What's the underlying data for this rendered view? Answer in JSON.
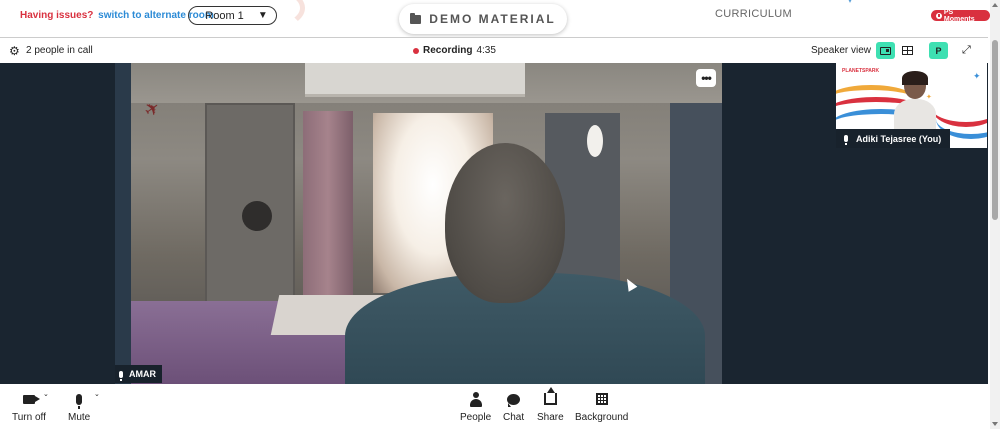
{
  "topbar": {
    "issue_text": "Having issues?",
    "alternate_link": "switch to alternate room",
    "room_select": "Room 1",
    "demo_button": "DEMO MATERIAL",
    "curriculum": "CURRICULUM",
    "moments_badge": "PS Moments"
  },
  "callbar": {
    "people_count": "2 people in call",
    "recording_label": "Recording",
    "recording_time": "4:35",
    "view_label": "Speaker view",
    "participant_initial": "P"
  },
  "stage": {
    "main_speaker": "AMAR",
    "self_name": "Adiki Tejasree (You)",
    "self_logo": "PLANETSPARK"
  },
  "toolbar": {
    "camera_label": "Turn off",
    "mic_label": "Mute",
    "people_label": "People",
    "chat_label": "Chat",
    "share_label": "Share",
    "background_label": "Background"
  },
  "colors": {
    "accent": "#3ee0b2",
    "recording": "#d9313f",
    "warning": "#d9313f",
    "link": "#2c8bd6",
    "stage_bg": "#1a2530"
  }
}
